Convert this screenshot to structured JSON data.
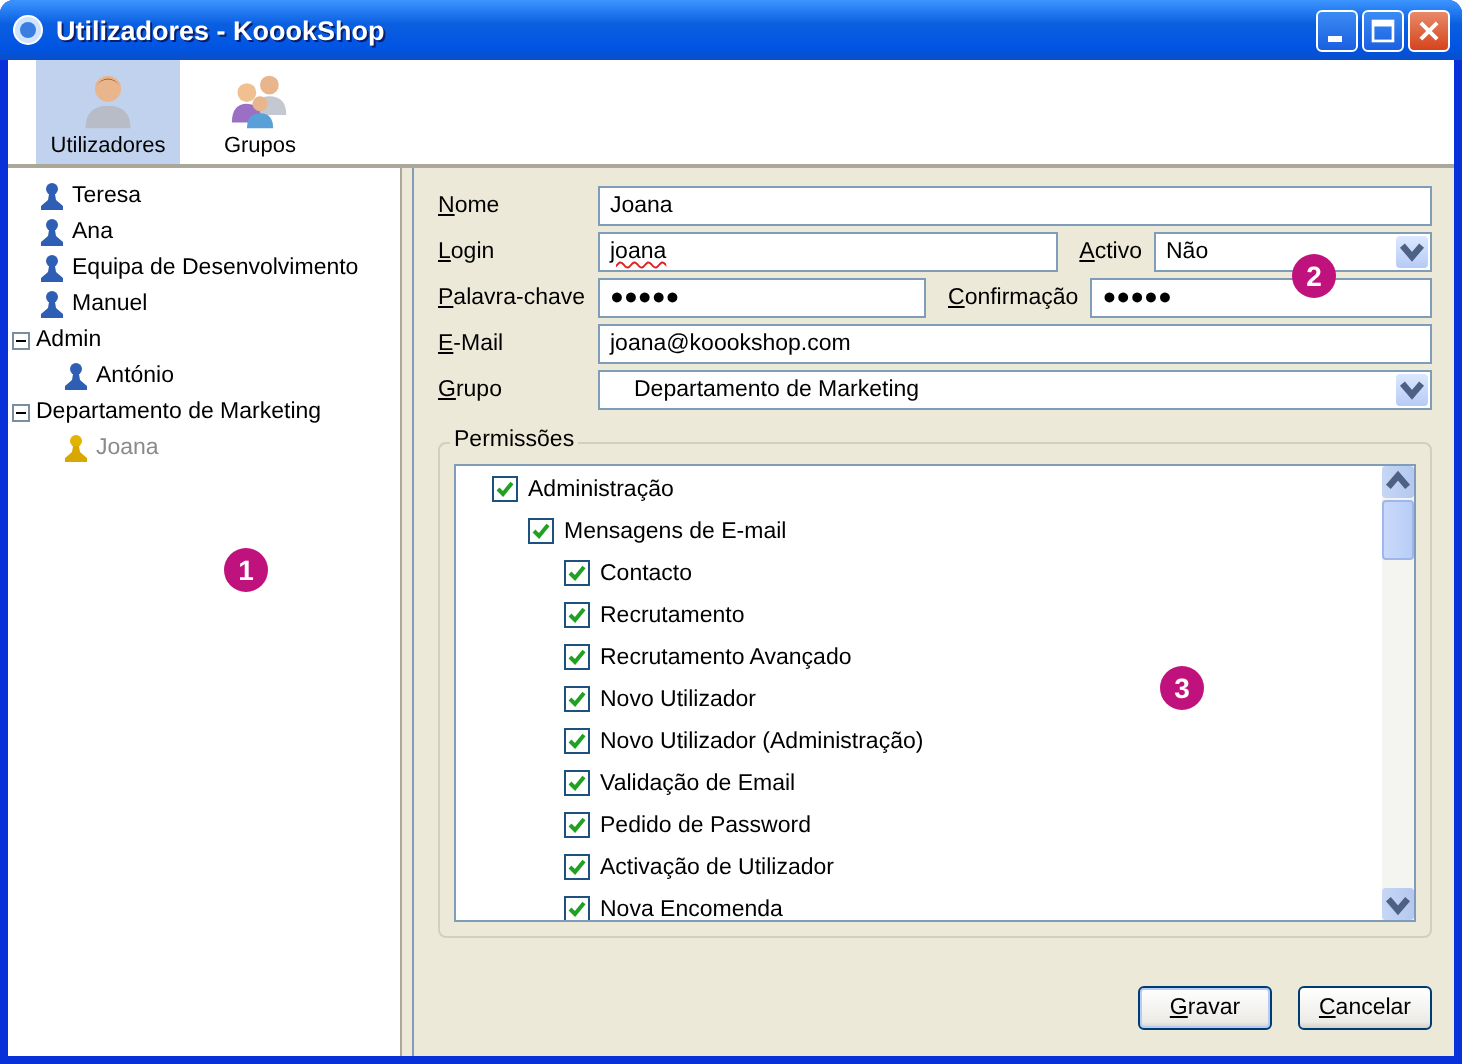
{
  "window": {
    "title": "Utilizadores - KoookShop"
  },
  "toolbar": [
    {
      "label": "Utilizadores",
      "kind": "user",
      "selected": true
    },
    {
      "label": "Grupos",
      "kind": "group",
      "selected": false
    }
  ],
  "tree": [
    {
      "label": "Teresa",
      "kind": "user",
      "selected": false
    },
    {
      "label": "Ana",
      "kind": "user",
      "selected": false
    },
    {
      "label": "Equipa de Desenvolvimento",
      "kind": "user",
      "selected": false
    },
    {
      "label": "Manuel",
      "kind": "user",
      "selected": false
    },
    {
      "label": "Admin",
      "kind": "group",
      "expanded": true,
      "children": [
        {
          "label": "António",
          "kind": "user",
          "selected": false
        }
      ]
    },
    {
      "label": "Departamento de Marketing",
      "kind": "group",
      "expanded": true,
      "children": [
        {
          "label": "Joana",
          "kind": "user",
          "selected": true
        }
      ]
    }
  ],
  "form": {
    "name": {
      "label": "Nome",
      "value": "Joana"
    },
    "login": {
      "label": "Login",
      "value": "joana"
    },
    "active": {
      "label": "Activo",
      "value": "Não"
    },
    "password": {
      "label": "Palavra-chave",
      "value": "●●●●●"
    },
    "confirm": {
      "label": "Confirmação",
      "value": "●●●●●"
    },
    "email": {
      "label": "E-Mail",
      "value": "joana@koookshop.com"
    },
    "group": {
      "label": "Grupo",
      "value": "Departamento de Marketing"
    }
  },
  "permissions": {
    "title": "Permissões",
    "items": [
      {
        "label": "Administração",
        "checked": true,
        "children": [
          {
            "label": "Mensagens de E-mail",
            "checked": true,
            "children": [
              {
                "label": "Contacto",
                "checked": true
              },
              {
                "label": "Recrutamento",
                "checked": true
              },
              {
                "label": "Recrutamento Avançado",
                "checked": true
              },
              {
                "label": "Novo Utilizador",
                "checked": true
              },
              {
                "label": "Novo Utilizador (Administração)",
                "checked": true
              },
              {
                "label": "Validação de Email",
                "checked": true
              },
              {
                "label": "Pedido de Password",
                "checked": true
              },
              {
                "label": "Activação de Utilizador",
                "checked": true
              },
              {
                "label": "Nova Encomenda",
                "checked": true
              }
            ]
          }
        ]
      }
    ]
  },
  "buttons": [
    "Gravar",
    "Cancelar"
  ],
  "callouts": [
    "1",
    "2",
    "3"
  ]
}
